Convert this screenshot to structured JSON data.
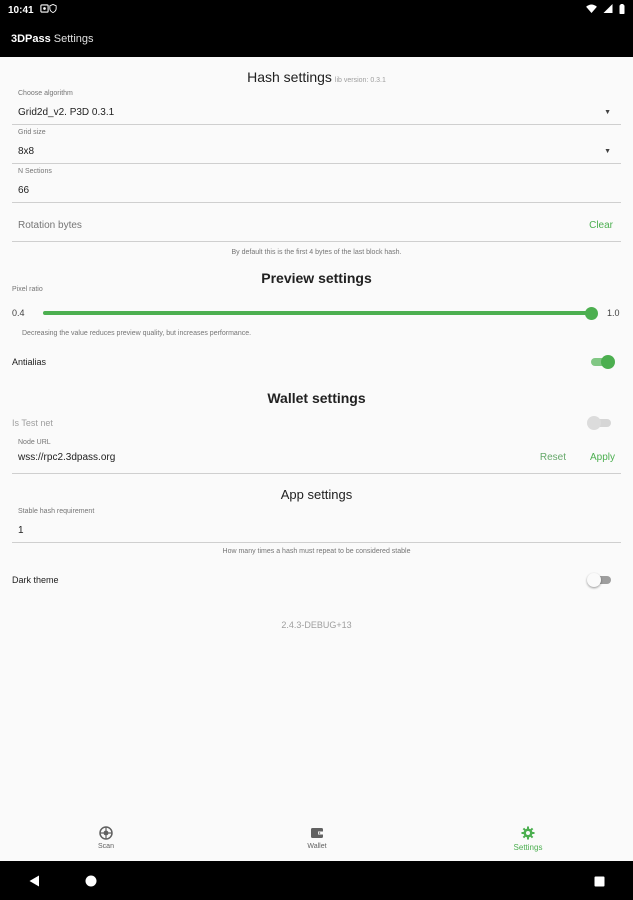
{
  "status_bar": {
    "time": "10:41"
  },
  "app_bar": {
    "brand": "3DPass",
    "title": "Settings"
  },
  "hash_settings": {
    "title": "Hash settings",
    "lib_version": "lib version: 0.3.1",
    "algorithm": {
      "label": "Choose algorithm",
      "value": "Grid2d_v2. P3D 0.3.1"
    },
    "grid_size": {
      "label": "Grid size",
      "value": "8x8"
    },
    "n_sections": {
      "label": "N Sections",
      "value": "66"
    },
    "rotation_bytes": {
      "placeholder": "Rotation bytes",
      "clear_label": "Clear"
    },
    "rotation_help": "By default this is the first 4 bytes of the last block hash."
  },
  "preview_settings": {
    "title": "Preview settings",
    "pixel_ratio_label": "Pixel ratio",
    "min_label": "0.4",
    "max_label": "1.0",
    "pixel_ratio_value": 1.0,
    "help": "Decreasing the value reduces preview quality, but increases performance.",
    "antialias_label": "Antialias",
    "antialias_on": true
  },
  "wallet_settings": {
    "title": "Wallet settings",
    "testnet_label": "Is Test net",
    "testnet_on": false,
    "node_url": {
      "label": "Node URL",
      "value": "wss://rpc2.3dpass.org",
      "reset_label": "Reset",
      "apply_label": "Apply"
    }
  },
  "app_settings": {
    "title": "App settings",
    "stable_hash": {
      "label": "Stable hash requirement",
      "value": "1"
    },
    "stable_help": "How many times a hash must repeat to be considered stable",
    "dark_theme_label": "Dark theme",
    "dark_theme_on": false
  },
  "version": "2.4.3-DEBUG+13",
  "bottom_nav": [
    {
      "label": "Scan",
      "icon": "scan-icon",
      "active": false
    },
    {
      "label": "Wallet",
      "icon": "wallet-icon",
      "active": false
    },
    {
      "label": "Settings",
      "icon": "gear-icon",
      "active": true
    }
  ],
  "colors": {
    "accent": "#4caf50",
    "bar": "#000000",
    "background": "#fafafa"
  }
}
